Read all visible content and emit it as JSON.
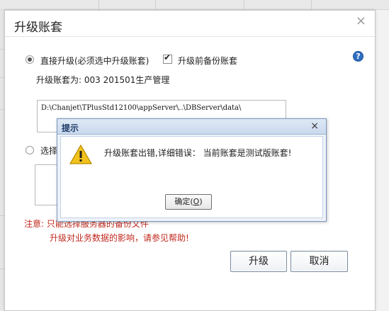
{
  "dialog": {
    "title": "升级账套",
    "close_glyph": "×",
    "direct_upgrade": {
      "label": "直接升级(必须选中升级账套)",
      "checked": true
    },
    "backup_before": {
      "label": "升级前备份账套",
      "checked": true
    },
    "account_line": "升级账套为: 003 201501生产管理",
    "path_value": "D:\\Chanjet\\TPlusStd12100\\appServer\\..\\DBServer\\data\\",
    "select_option_label": "选择",
    "note_line1": "注意: 只能选择服务器的备份文件",
    "note_line2": "升级对业务数据的影响，请参见帮助!",
    "help_glyph": "?",
    "upgrade_button": "升级",
    "cancel_button": "取消"
  },
  "alert": {
    "title": "提示",
    "close_glyph": "×",
    "message": "升级账套出错,详细错误： 当前账套是测试版账套!",
    "ok_label_prefix": "确定(",
    "ok_label_mnemonic": "O",
    "ok_label_suffix": ")"
  },
  "colors": {
    "accent_blue": "#2f6fc0",
    "note_red": "#c0281e",
    "alert_title_text": "#1e3a66",
    "warning_yellow": "#f2c21b"
  }
}
